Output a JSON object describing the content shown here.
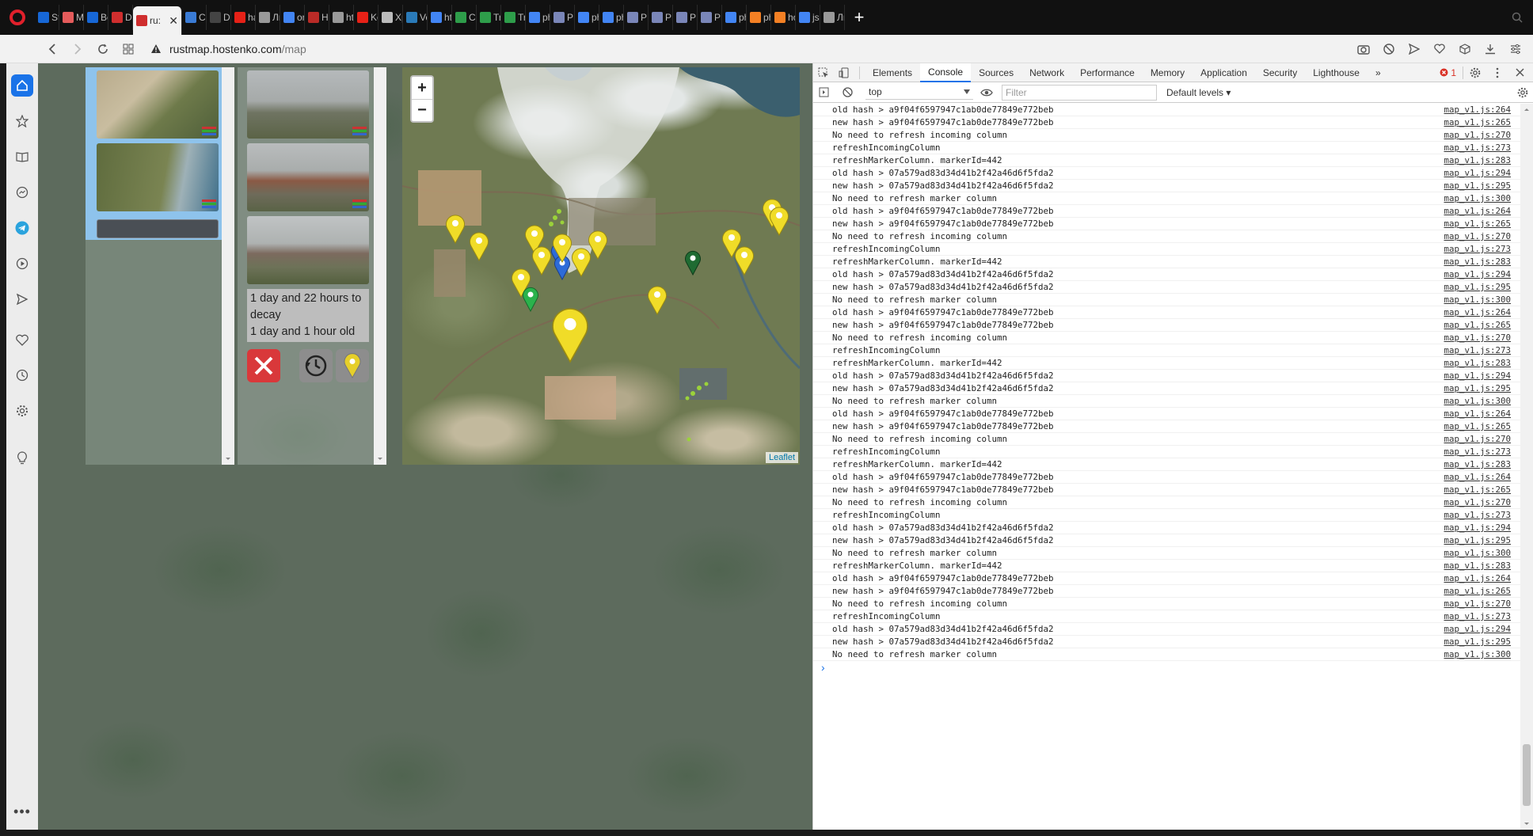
{
  "tabs": [
    {
      "label": "Sta",
      "icon": "trello-icon",
      "color": "#1767d6"
    },
    {
      "label": "Ма",
      "icon": "ui-icon",
      "color": "#e45b5b"
    },
    {
      "label": "Bcr",
      "icon": "trello-icon",
      "color": "#1767d6"
    },
    {
      "label": "Day",
      "icon": "rust-icon",
      "color": "#cf2e2e"
    },
    {
      "label": "ru:",
      "icon": "rust-icon",
      "color": "#cf2e2e",
      "active": true
    },
    {
      "label": "Co",
      "icon": "link-icon",
      "color": "#3a7bd5"
    },
    {
      "label": "Do",
      "icon": "7z-icon",
      "color": "#444"
    },
    {
      "label": "ha!",
      "icon": "youtube-icon",
      "color": "#e62117"
    },
    {
      "label": "Ли",
      "icon": "glasses-icon",
      "color": "#999"
    },
    {
      "label": "onl",
      "icon": "google-icon",
      "color": "#4285f4"
    },
    {
      "label": "Ho",
      "icon": "quora-icon",
      "color": "#b92b27"
    },
    {
      "label": "htt",
      "icon": "shield-icon",
      "color": "#999"
    },
    {
      "label": "Ko",
      "icon": "youtube-icon",
      "color": "#e62117"
    },
    {
      "label": "Xp",
      "icon": "spider-icon",
      "color": "#bbb"
    },
    {
      "label": "Ver",
      "icon": "check-icon",
      "color": "#2a7ab8"
    },
    {
      "label": "htn",
      "icon": "google-icon",
      "color": "#4285f4"
    },
    {
      "label": "CSS",
      "icon": "w3-icon",
      "color": "#2e9d4a"
    },
    {
      "label": "Try",
      "icon": "w3-icon",
      "color": "#2e9d4a"
    },
    {
      "label": "Try",
      "icon": "w3-icon",
      "color": "#2e9d4a"
    },
    {
      "label": "ph",
      "icon": "google-icon",
      "color": "#4285f4"
    },
    {
      "label": "PH",
      "icon": "php-icon",
      "color": "#7a86b8"
    },
    {
      "label": "ph",
      "icon": "google-icon",
      "color": "#4285f4"
    },
    {
      "label": "ph",
      "icon": "google-icon",
      "color": "#4285f4"
    },
    {
      "label": "PH",
      "icon": "php-icon",
      "color": "#7a86b8"
    },
    {
      "label": "PH",
      "icon": "php-icon",
      "color": "#7a86b8"
    },
    {
      "label": "PH",
      "icon": "php-icon",
      "color": "#7a86b8"
    },
    {
      "label": "PH",
      "icon": "php-icon",
      "color": "#7a86b8"
    },
    {
      "label": "ph",
      "icon": "google-icon",
      "color": "#4285f4"
    },
    {
      "label": "ph",
      "icon": "stack-icon",
      "color": "#f48024"
    },
    {
      "label": "ho",
      "icon": "stack-icon",
      "color": "#f48024"
    },
    {
      "label": "js c",
      "icon": "google-icon",
      "color": "#4285f4"
    },
    {
      "label": "Ли",
      "icon": "glasses-icon",
      "color": "#999"
    }
  ],
  "address": {
    "host": "rustmap.hostenko.com",
    "path": "/map"
  },
  "detail": {
    "decay_text": "1 day and 22 hours to decay",
    "age_text": "1 day and 1 hour old"
  },
  "map": {
    "zoom_in": "+",
    "zoom_out": "−",
    "attribution": "Leaflet"
  },
  "devtools": {
    "tabs": [
      "Elements",
      "Console",
      "Sources",
      "Network",
      "Performance",
      "Memory",
      "Application",
      "Security",
      "Lighthouse"
    ],
    "active_tab": "Console",
    "more": "»",
    "error_count": "1",
    "context": "top",
    "filter_placeholder": "Filter",
    "levels": "Default levels ▾",
    "prompt": "›"
  },
  "console_lines": [
    {
      "msg": "old hash > a9f04f6597947c1ab0de77849e772beb",
      "src": "map_v1.js:264"
    },
    {
      "msg": "new hash > a9f04f6597947c1ab0de77849e772beb",
      "src": "map_v1.js:265"
    },
    {
      "msg": "No need to refresh incoming column",
      "src": "map_v1.js:270"
    },
    {
      "msg": "refreshIncomingColumn",
      "src": "map_v1.js:273"
    },
    {
      "msg": "refreshMarkerColumn. markerId=442",
      "src": "map_v1.js:283"
    },
    {
      "msg": "old hash > 07a579ad83d34d41b2f42a46d6f5fda2",
      "src": "map_v1.js:294"
    },
    {
      "msg": "new hash > 07a579ad83d34d41b2f42a46d6f5fda2",
      "src": "map_v1.js:295"
    },
    {
      "msg": "No need to refresh marker column",
      "src": "map_v1.js:300"
    },
    {
      "msg": "old hash > a9f04f6597947c1ab0de77849e772beb",
      "src": "map_v1.js:264"
    },
    {
      "msg": "new hash > a9f04f6597947c1ab0de77849e772beb",
      "src": "map_v1.js:265"
    },
    {
      "msg": "No need to refresh incoming column",
      "src": "map_v1.js:270"
    },
    {
      "msg": "refreshIncomingColumn",
      "src": "map_v1.js:273"
    },
    {
      "msg": "refreshMarkerColumn. markerId=442",
      "src": "map_v1.js:283"
    },
    {
      "msg": "old hash > 07a579ad83d34d41b2f42a46d6f5fda2",
      "src": "map_v1.js:294"
    },
    {
      "msg": "new hash > 07a579ad83d34d41b2f42a46d6f5fda2",
      "src": "map_v1.js:295"
    },
    {
      "msg": "No need to refresh marker column",
      "src": "map_v1.js:300"
    },
    {
      "msg": "old hash > a9f04f6597947c1ab0de77849e772beb",
      "src": "map_v1.js:264"
    },
    {
      "msg": "new hash > a9f04f6597947c1ab0de77849e772beb",
      "src": "map_v1.js:265"
    },
    {
      "msg": "No need to refresh incoming column",
      "src": "map_v1.js:270"
    },
    {
      "msg": "refreshIncomingColumn",
      "src": "map_v1.js:273"
    },
    {
      "msg": "refreshMarkerColumn. markerId=442",
      "src": "map_v1.js:283"
    },
    {
      "msg": "old hash > 07a579ad83d34d41b2f42a46d6f5fda2",
      "src": "map_v1.js:294"
    },
    {
      "msg": "new hash > 07a579ad83d34d41b2f42a46d6f5fda2",
      "src": "map_v1.js:295"
    },
    {
      "msg": "No need to refresh marker column",
      "src": "map_v1.js:300"
    },
    {
      "msg": "old hash > a9f04f6597947c1ab0de77849e772beb",
      "src": "map_v1.js:264"
    },
    {
      "msg": "new hash > a9f04f6597947c1ab0de77849e772beb",
      "src": "map_v1.js:265"
    },
    {
      "msg": "No need to refresh incoming column",
      "src": "map_v1.js:270"
    },
    {
      "msg": "refreshIncomingColumn",
      "src": "map_v1.js:273"
    },
    {
      "msg": "refreshMarkerColumn. markerId=442",
      "src": "map_v1.js:283"
    },
    {
      "msg": "old hash > a9f04f6597947c1ab0de77849e772beb",
      "src": "map_v1.js:264"
    },
    {
      "msg": "new hash > a9f04f6597947c1ab0de77849e772beb",
      "src": "map_v1.js:265"
    },
    {
      "msg": "No need to refresh incoming column",
      "src": "map_v1.js:270"
    },
    {
      "msg": "refreshIncomingColumn",
      "src": "map_v1.js:273"
    },
    {
      "msg": "old hash > 07a579ad83d34d41b2f42a46d6f5fda2",
      "src": "map_v1.js:294"
    },
    {
      "msg": "new hash > 07a579ad83d34d41b2f42a46d6f5fda2",
      "src": "map_v1.js:295"
    },
    {
      "msg": "No need to refresh marker column",
      "src": "map_v1.js:300"
    },
    {
      "msg": "refreshMarkerColumn. markerId=442",
      "src": "map_v1.js:283"
    },
    {
      "msg": "old hash > a9f04f6597947c1ab0de77849e772beb",
      "src": "map_v1.js:264"
    },
    {
      "msg": "new hash > a9f04f6597947c1ab0de77849e772beb",
      "src": "map_v1.js:265"
    },
    {
      "msg": "No need to refresh incoming column",
      "src": "map_v1.js:270"
    },
    {
      "msg": "refreshIncomingColumn",
      "src": "map_v1.js:273"
    },
    {
      "msg": "old hash > 07a579ad83d34d41b2f42a46d6f5fda2",
      "src": "map_v1.js:294"
    },
    {
      "msg": "new hash > 07a579ad83d34d41b2f42a46d6f5fda2",
      "src": "map_v1.js:295"
    },
    {
      "msg": "No need to refresh marker column",
      "src": "map_v1.js:300"
    }
  ]
}
